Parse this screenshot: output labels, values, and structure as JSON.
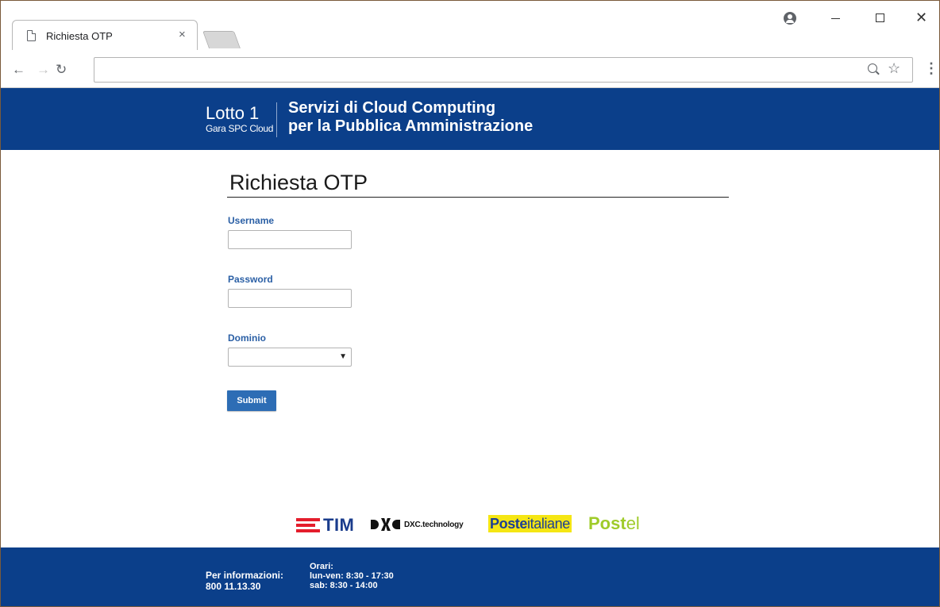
{
  "browser": {
    "tab_title": "Richiesta OTP",
    "tab_close": "×",
    "url": ""
  },
  "icons": {
    "back": "arrow-left-icon",
    "forward": "arrow-right-icon",
    "reload": "reload-icon",
    "zoom": "zoom-icon",
    "bookmark": "star-icon",
    "menu": "kebab-menu-icon",
    "profile": "profile-icon"
  },
  "header": {
    "lotto": "Lotto 1",
    "gara": "Gara SPC Cloud",
    "title_line1": "Servizi di Cloud Computing",
    "title_line2": "per la Pubblica Amministrazione"
  },
  "form": {
    "title": "Richiesta OTP",
    "username_label": "Username",
    "username_value": "",
    "password_label": "Password",
    "password_value": "",
    "dominio_label": "Dominio",
    "dominio_value": "",
    "submit_label": "Submit"
  },
  "logos": {
    "tim": "TIM",
    "dxc": "DXC.technology",
    "poste_bold": "Poste",
    "poste_light": "italiane",
    "postel_bold": "Post",
    "postel_light": "el"
  },
  "footer": {
    "info_label": "Per informazioni:",
    "info_phone": "800 11.13.30",
    "hours_label": "Orari:",
    "hours_weekday": "lun-ven: 8:30 - 17:30",
    "hours_saturday": "sab: 8:30 - 14:00"
  },
  "colors": {
    "brand_blue": "#0b3f8a",
    "label_blue": "#2a5fa5",
    "button_blue": "#2d6db5",
    "tim_red": "#e41d2c",
    "poste_yellow": "#f5e614",
    "postel_green": "#9fcb2a"
  }
}
